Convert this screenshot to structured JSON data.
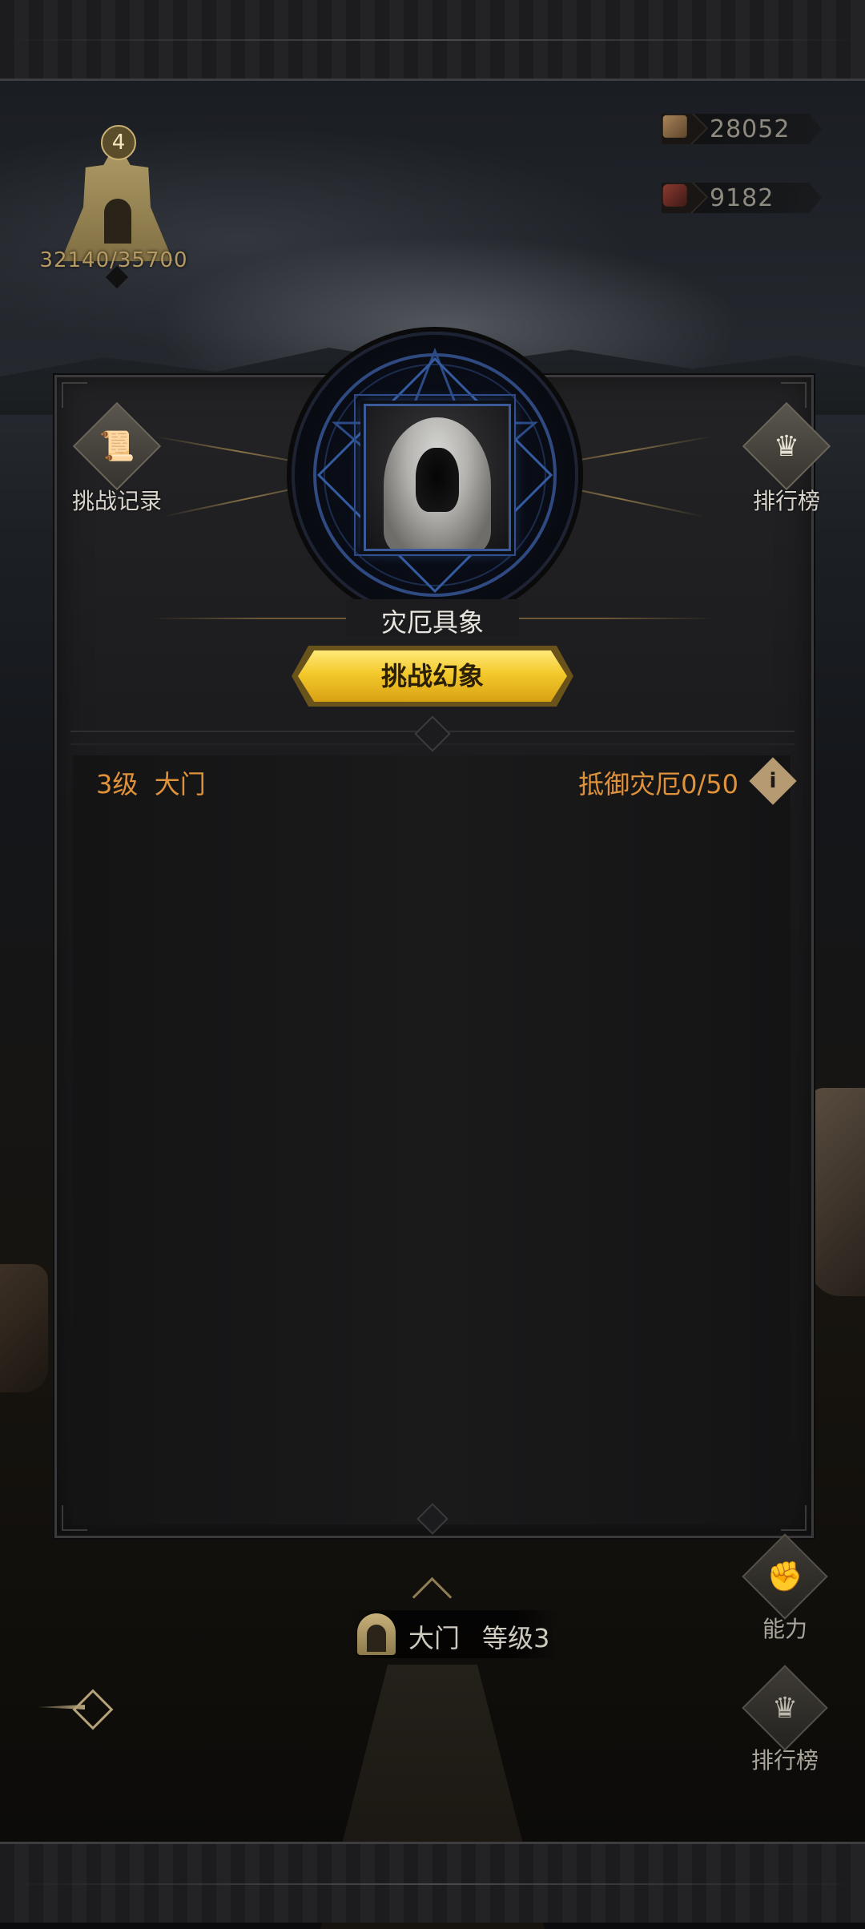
{
  "city": {
    "level": "4",
    "progress": "32140/35700"
  },
  "resources": [
    {
      "icon": "wood-crate-icon",
      "value": "28052"
    },
    {
      "icon": "leather-icon",
      "value": "9182"
    }
  ],
  "panel": {
    "left_button": {
      "label": "挑战记录",
      "icon": "scroll-icon"
    },
    "right_button": {
      "label": "排行榜",
      "icon": "crown-icon"
    },
    "boss_name": "灾厄具象",
    "challenge_button": "挑战幻象",
    "level_text": "3级  大门",
    "resist_text": "抵御灾厄0/50",
    "info_icon": "i"
  },
  "hud": {
    "building_name": "大门",
    "building_level": "等级3",
    "right_buttons": [
      {
        "label": "能力",
        "icon": "fist-icon"
      },
      {
        "label": "排行榜",
        "icon": "crown-icon"
      }
    ]
  },
  "colors": {
    "accent_orange": "#e0923a",
    "gold_button": "#f3c92b",
    "emblem_blue": "#3a5a9a"
  }
}
